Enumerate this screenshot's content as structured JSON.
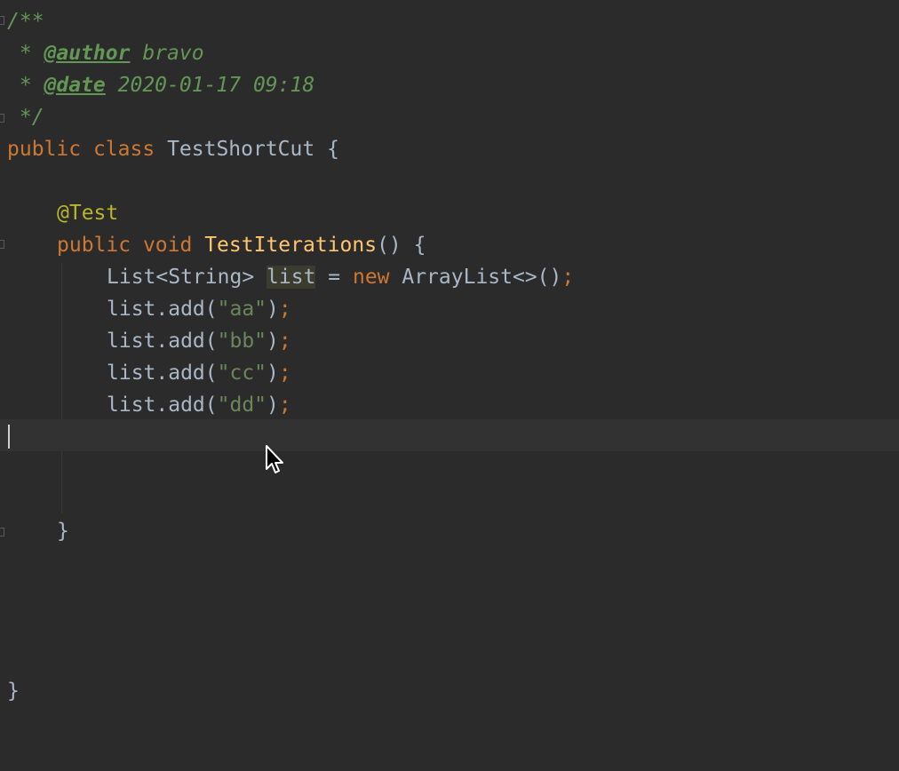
{
  "editor": {
    "language": "Java",
    "lines": {
      "l1": "/**",
      "l2_star": " * ",
      "l2_tag": "@author",
      "l2_val": " bravo",
      "l3_star": " * ",
      "l3_tag": "@date",
      "l3_val": " 2020-01-17 09:18",
      "l4": " */",
      "l5_public": "public",
      "l5_class": "class",
      "l5_name": "TestShortCut",
      "l5_brace": "{",
      "l7_annotation": "@Test",
      "l8_public": "public",
      "l8_void": "void",
      "l8_method": "TestIterations",
      "l8_rest": "() {",
      "l9_type": "List<String>",
      "l9_var": "list",
      "l9_eq": " = ",
      "l9_new": "new",
      "l9_ctor": " ArrayList<>()",
      "l9_semi": ";",
      "add_prefix": "list.add(",
      "add_close": ")",
      "semicolon": ";",
      "s_aa": "\"aa\"",
      "s_bb": "\"bb\"",
      "s_cc": "\"cc\"",
      "s_dd": "\"dd\"",
      "method_close": "}",
      "class_close": "}"
    }
  },
  "colors": {
    "background": "#2b2b2b",
    "keyword": "#cc7832",
    "comment": "#629755",
    "annotation": "#bbb529",
    "method": "#ffc66d",
    "string": "#6a8759",
    "text": "#a9b7c6"
  }
}
